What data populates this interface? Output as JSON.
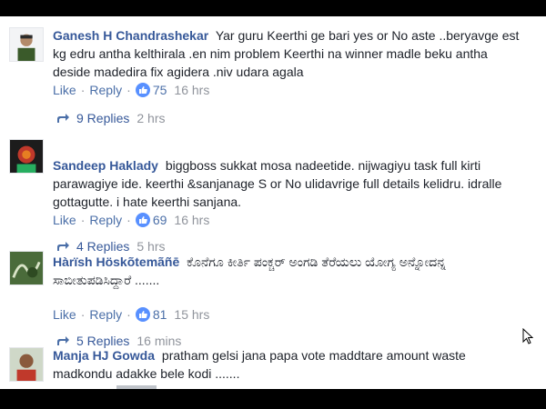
{
  "comments": [
    {
      "author": "Ganesh H Chandrashekar",
      "text": "Yar guru Keerthi ge bari yes or No aste ..beryavge est kg edru antha kelthirala .en nim problem Keerthi na winner madle beku antha deside madedira fix agidera .niv udara agala",
      "like_label": "Like",
      "reply_label": "Reply",
      "likes": "75",
      "time": "16 hrs",
      "replies_label": "9 Replies",
      "replies_time": "2 hrs"
    },
    {
      "author": "Sandeep Haklady",
      "text": "biggboss sukkat mosa nadeetide. nijwagiyu task full kirti parawagiye ide. keerthi &sanjanage S or No ulidavrige full details kelidru. idralle gottagutte. i hate keerthi sanjana.",
      "like_label": "Like",
      "reply_label": "Reply",
      "likes": "69",
      "time": "16 hrs",
      "replies_label": "4 Replies",
      "replies_time": "5 hrs"
    },
    {
      "author": "Hàrïsh Höskõtemãñē",
      "text": "ಕೊನೆಗೂ ಕೀರ್ತಿ ಪಂಕ್ಚರ್ ಅಂಗಡಿ ತೆರೆಯಲು ಯೋಗ್ಯ ಅನ್ನೋದನ್ನ ಸಾಬೀತುಪಡಿಸಿದ್ದಾರೆ .......",
      "like_label": "Like",
      "reply_label": "Reply",
      "likes": "81",
      "time": "15 hrs",
      "replies_label": "5 Replies",
      "replies_time": "16 mins"
    },
    {
      "author": "Manja HJ Gowda",
      "text": "pratham gelsi jana papa vote maddtare amount waste madkondu adakke bele kodi ......."
    }
  ],
  "colors": {
    "author": "#365899",
    "link": "#4b6fa8",
    "muted": "#90949c",
    "like_badge": "#5890ff"
  }
}
